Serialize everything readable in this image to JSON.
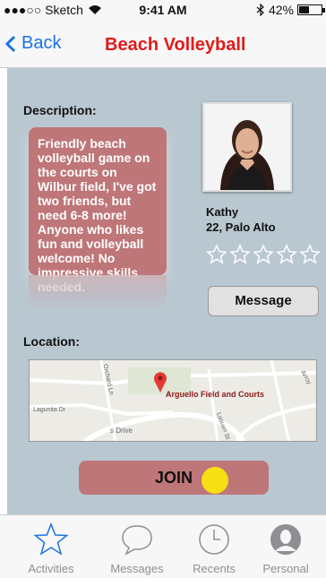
{
  "status_bar": {
    "carrier": "●●●○○ Sketch",
    "time": "9:41 AM",
    "battery": "42%",
    "icons": [
      "wifi-icon",
      "bluetooth-icon",
      "battery-icon"
    ]
  },
  "nav": {
    "back_label": "Back",
    "title": "Beach Volleyball",
    "back_color": "#1a73e8",
    "title_color": "#e01b1b"
  },
  "event": {
    "description_label": "Description:",
    "description": "Friendly beach volleyball game on the courts on Wilbur field, I've got two friends, but need 6-8 more! Anyone who likes fun and volleyball welcome! No impressive skills needed.",
    "card_color": "#bf7678"
  },
  "host": {
    "name": "Kathy",
    "info": "22, Palo Alto",
    "rating": 0,
    "max_rating": 5,
    "message_label": "Message"
  },
  "location": {
    "label": "Location:",
    "map_labels": {
      "place": "Arguello Field and Courts",
      "street_1": "Lagunita Dr",
      "street_2": "Orchard Ln",
      "street_3": "s Drive",
      "street_4": "Lasuen St",
      "street_5": "Arroy"
    }
  },
  "join_label": "JOIN",
  "tabs": [
    {
      "label": "Activities",
      "icon": "star-icon",
      "active": true
    },
    {
      "label": "Messages",
      "icon": "chat-bubble-icon",
      "active": false
    },
    {
      "label": "Recents",
      "icon": "clock-icon",
      "active": false
    },
    {
      "label": "Personal",
      "icon": "person-icon",
      "active": false
    }
  ],
  "colors": {
    "content_bg": "#b9c7d1",
    "accent_blue": "#1a73e8",
    "touch_indicator": "#fff200"
  }
}
